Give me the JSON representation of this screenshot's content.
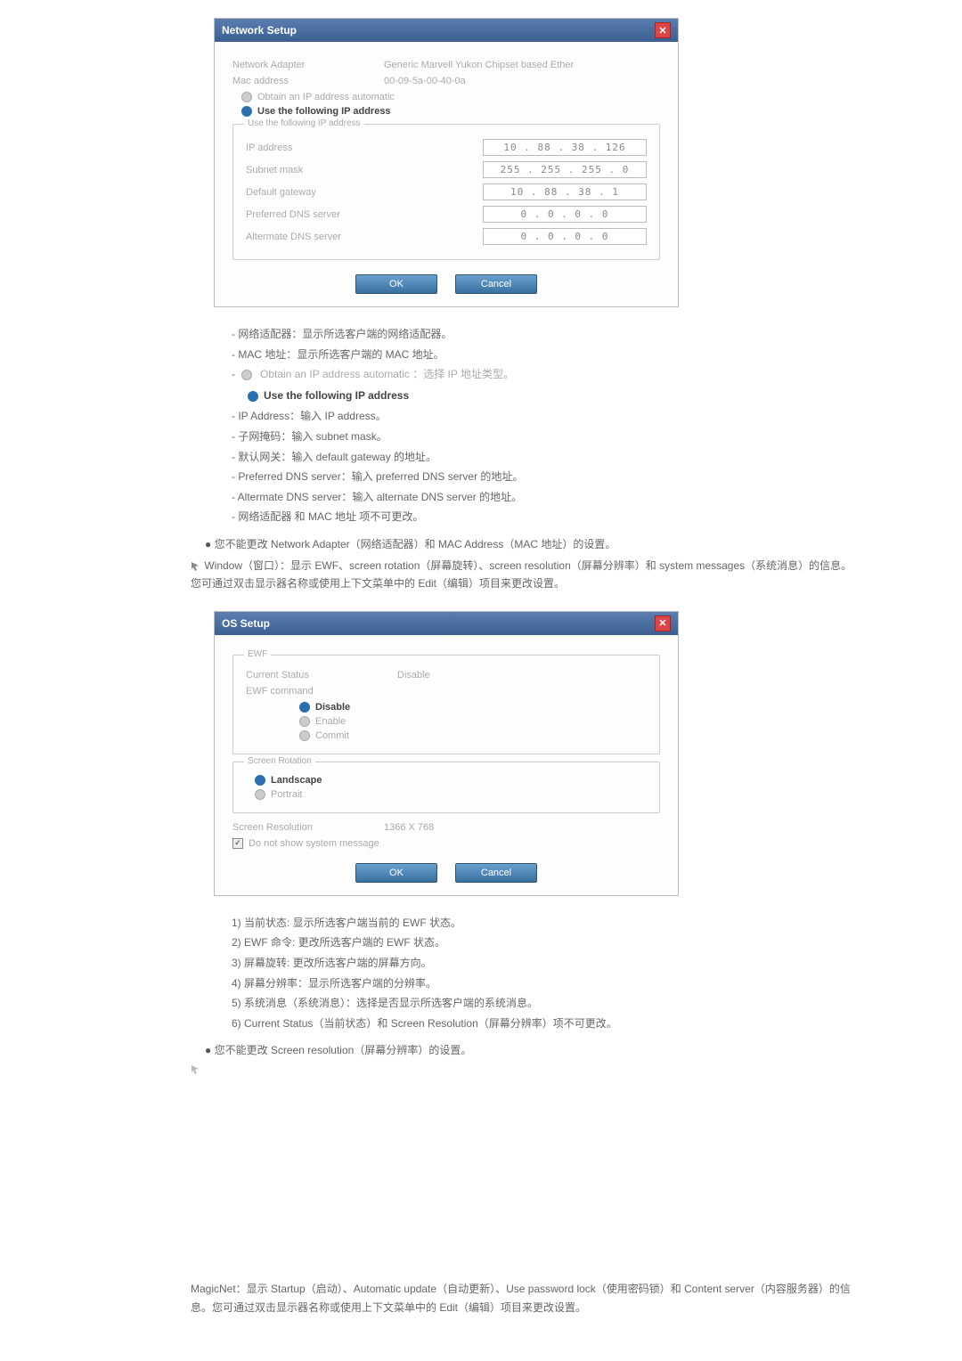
{
  "network_dialog": {
    "title": "Network Setup",
    "row_adapter_label": "Network Adapter",
    "row_adapter_value": "Generic Marvell Yukon Chipset based Ether",
    "row_mac_label": "Mac address",
    "row_mac_value": "00-09-5a-00-40-0a",
    "radio_obtain": "Obtain an IP address automatic",
    "radio_following": "Use the following IP address",
    "fieldset_legend": "Use the following IP address",
    "ip_rows": [
      {
        "label": "IP address",
        "value": "10 . 88 . 38 . 126"
      },
      {
        "label": "Subnet mask",
        "value": "255 . 255 . 255 . 0"
      },
      {
        "label": "Default gateway",
        "value": "10 . 88 . 38 . 1"
      },
      {
        "label": "Preferred DNS server",
        "value": "0 . 0 . 0 . 0"
      },
      {
        "label": "Altermate DNS server",
        "value": "0 . 0 . 0 . 0"
      }
    ],
    "btn_ok": "OK",
    "btn_cancel": "Cancel"
  },
  "network_list": [
    "- 网络适配器：显示所选客户端的网络适配器。",
    "- MAC 地址：显示所选客户端的 MAC 地址。",
    "Obtain an IP address automatic ：选择 IP 地址类型。",
    "Use the following IP address",
    "- IP Address：输入 IP address。",
    "- 子网掩码：输入 subnet mask。",
    "- 默认网关：输入 default gateway 的地址。",
    "- Preferred DNS server：输入 preferred DNS server 的地址。",
    "- Altermate DNS server：输入 alternate DNS server 的地址。",
    "- 网络适配器 和 MAC 地址 项不可更改。"
  ],
  "note_network": "您不能更改 Network Adapter（网络适配器）和 MAC Address（MAC 地址）的设置。",
  "window_text": "Window（窗口）：显示 EWF、screen rotation（屏幕旋转）、screen resolution（屏幕分辨率）和 system messages（系统消息）的信息。您可通过双击显示器名称或使用上下文菜单中的 Edit（编辑）项目来更改设置。",
  "os_dialog": {
    "title": "OS Setup",
    "ewf_legend": "EWF",
    "current_status_label": "Current Status",
    "current_status_value": "Disable",
    "ewf_command_label": "EWF command",
    "opt_disable": "Disable",
    "opt_enable": "Enable",
    "opt_commit": "Commit",
    "rotation_legend": "Screen Rotation",
    "opt_landscape": "Landscape",
    "opt_portrait": "Portrait",
    "res_label": "Screen Resolution",
    "res_value": "1366 X 768",
    "check_label": "Do not show system message",
    "btn_ok": "OK",
    "btn_cancel": "Cancel"
  },
  "os_list": [
    "1) 当前状态: 显示所选客户端当前的 EWF 状态。",
    "2) EWF 命令: 更改所选客户端的 EWF 状态。",
    "3) 屏幕旋转: 更改所选客户端的屏幕方向。",
    "4) 屏幕分辨率：显示所选客户端的分辨率。",
    "5) 系统消息（系统消息）：选择是否显示所选客户端的系统消息。",
    "6) Current Status（当前状态）和 Screen Resolution（屏幕分辨率）项不可更改。"
  ],
  "note_os": "您不能更改 Screen resolution（屏幕分辨率）的设置。",
  "magicnet": "MagicNet：显示 Startup（启动）、Automatic update（自动更新）、Use password lock（使用密码锁）和 Content server（内容服务器）的信息。您可通过双击显示器名称或使用上下文菜单中的 Edit（编辑）项目来更改设置。"
}
